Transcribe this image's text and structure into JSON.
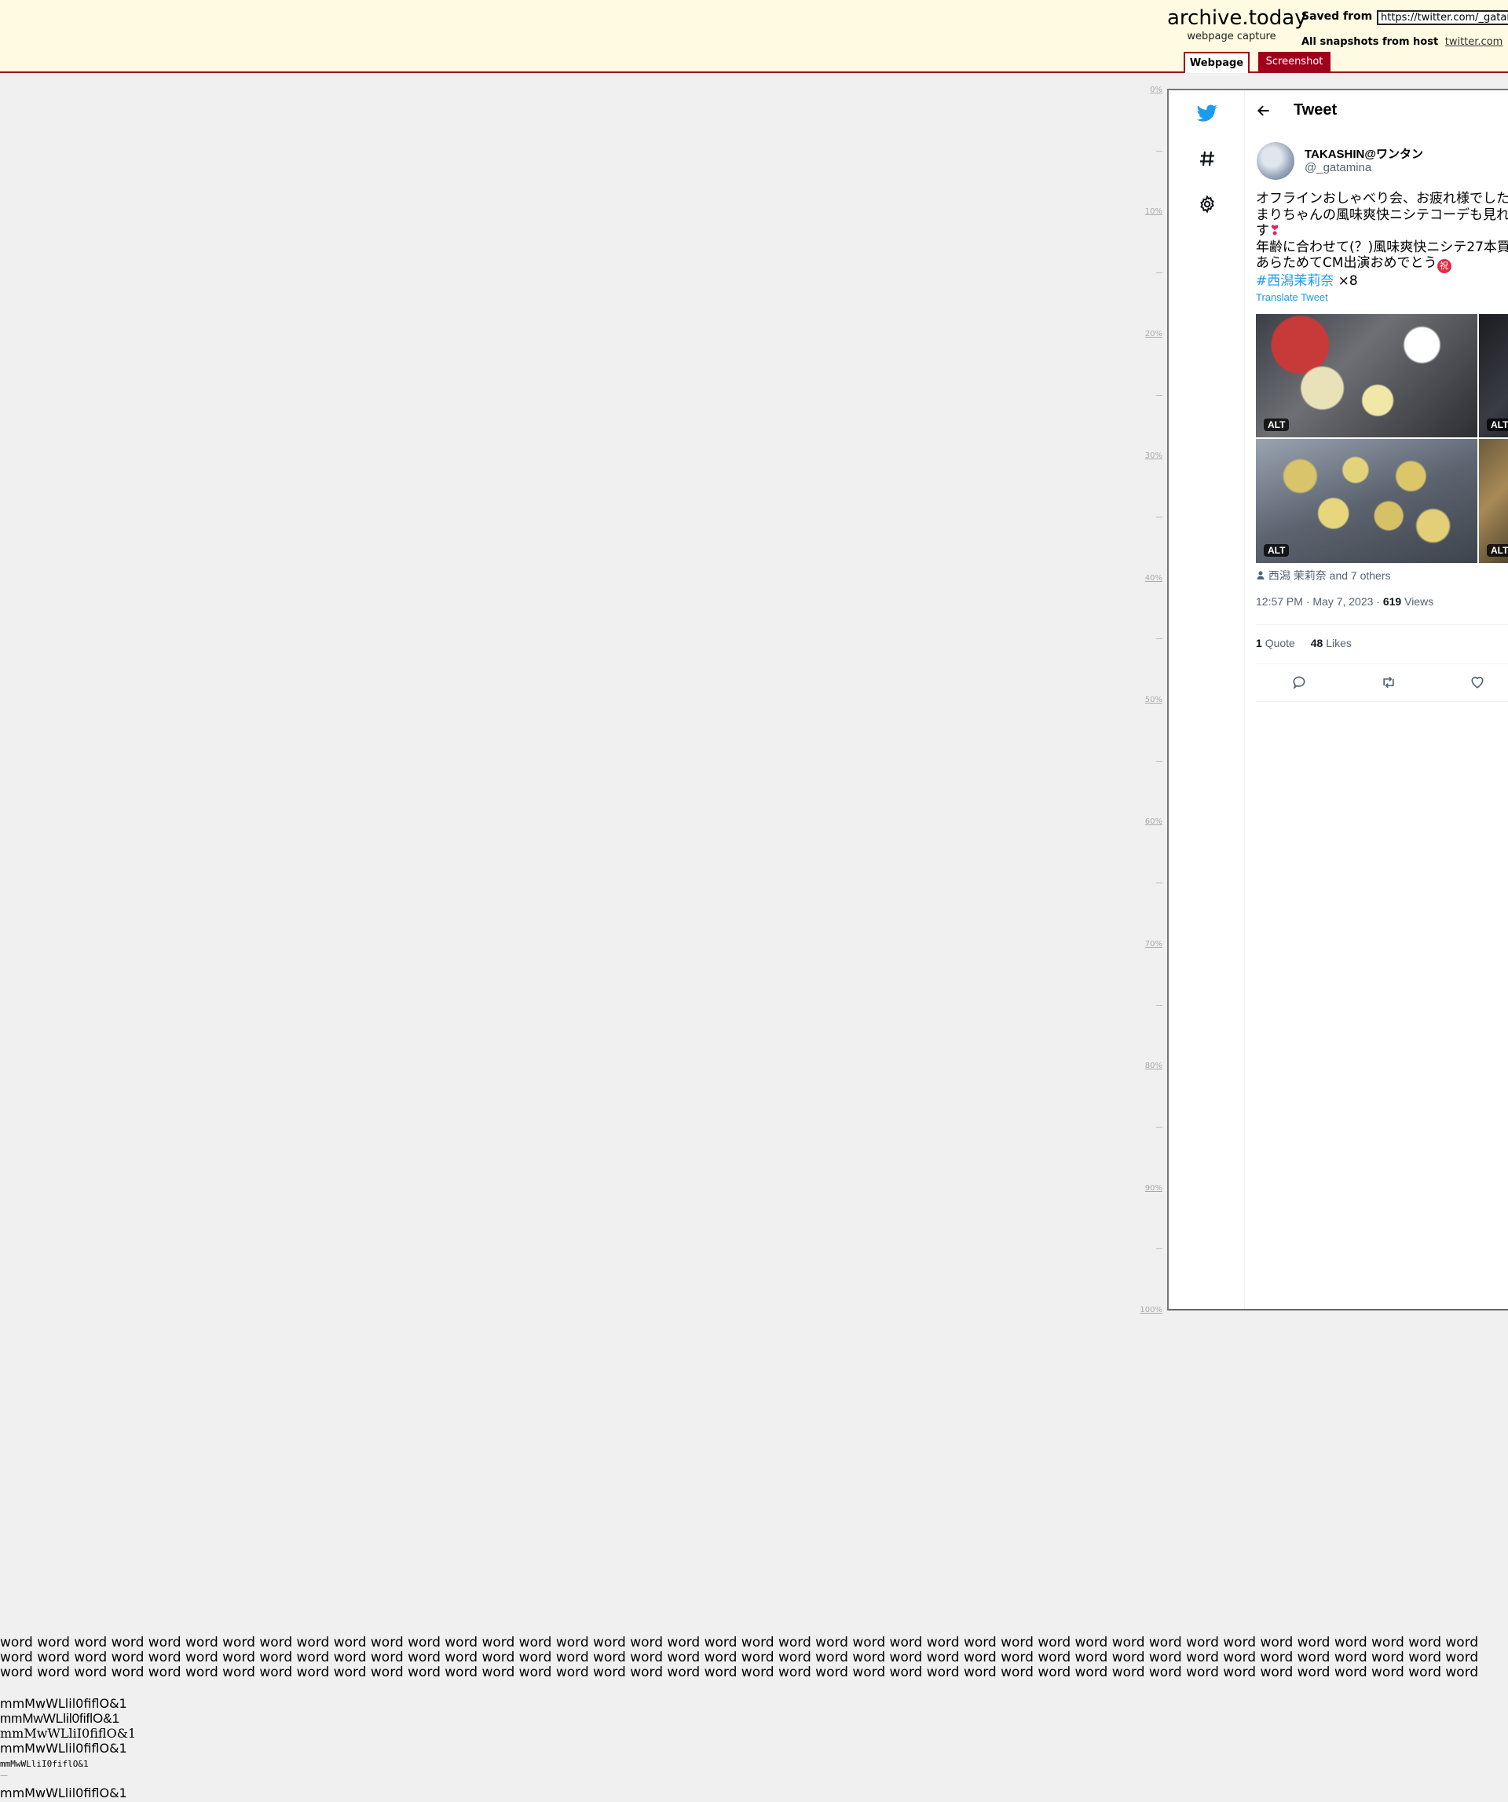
{
  "header": {
    "brand": "archive.today",
    "brand_sub": "webpage capture",
    "saved_from_label": "Saved from",
    "saved_from_url": "https://twitter.com/_gatamina",
    "all_snapshots_label": "All snapshots",
    "from_host_label": "from host",
    "host_link": "twitter.com",
    "tabs": {
      "webpage": "Webpage",
      "screenshot": "Screenshot"
    }
  },
  "ruler": [
    "0%",
    "10%",
    "20%",
    "30%",
    "40%",
    "50%",
    "60%",
    "70%",
    "80%",
    "90%",
    "100%"
  ],
  "nav": {
    "icons": [
      "twitter-logo-icon",
      "hashtag-icon",
      "settings-gear-icon"
    ],
    "brand_color": "#1d9bf0"
  },
  "tweet": {
    "page_title": "Tweet",
    "author_name": "TAKASHIN@ワンタン",
    "author_handle": "@_gatamina",
    "text_lines": [
      "オフラインおしゃべり会、お疲れ様でした",
      "まりちゃんの風味爽快ニシテコーデも見れ",
      "す",
      "年齢に合わせて(？)風味爽快ニシテ27本買",
      "あらためてCM出演おめでとう"
    ],
    "hashtag": "#西潟茉莉奈",
    "hashtag_suffix": " ×8",
    "iwai_glyph": "祝",
    "translate": "Translate Tweet",
    "alt_label": "ALT",
    "liked_by": "西潟 茉莉奈 and 7 others",
    "time": "12:57 PM · May 7, 2023 · ",
    "views_count": "619",
    "views_label": " Views",
    "quotes_count": "1",
    "quotes_label": "Quote",
    "likes_count": "48",
    "likes_label": "Likes",
    "link_color": "#1d9bf0"
  },
  "test_text": {
    "words": "word word word word word word word word word word word word word word word word word word word word word word word word word word word word word word word word word word word word word word word word word word word word word word word word word word word word word word word word word word word word word word word word word word word word word word word word word word word word word word word word word word word word word word word word word word word word word word word word word word word word word word word word word word word word word word word word word word word word word word word word word word word word word word word",
    "samples": [
      "mmMwWLlil0fiflO&1",
      "mmMwWLlil0fiflO&1",
      "mmMwWLliI0fiflO&1",
      "mmMwWLlil0fiflO&1",
      "mmMwWLliI0fiflO&1",
      "—",
      "mmMwWLlil0fiflO&1"
    ]
  }
}
